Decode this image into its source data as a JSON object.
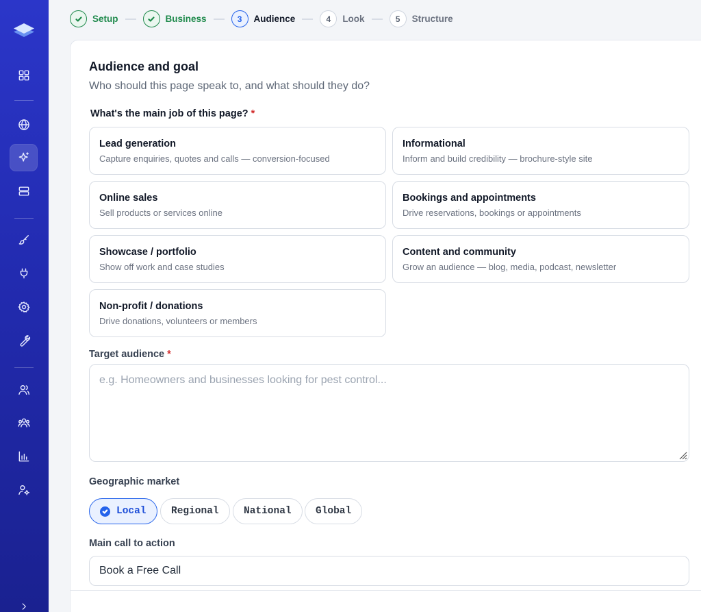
{
  "stepper": {
    "steps": [
      {
        "number": "1",
        "label": "Setup",
        "state": "done"
      },
      {
        "number": "2",
        "label": "Business",
        "state": "done"
      },
      {
        "number": "3",
        "label": "Audience",
        "state": "current"
      },
      {
        "number": "4",
        "label": "Look",
        "state": "todo"
      },
      {
        "number": "5",
        "label": "Structure",
        "state": "todo"
      }
    ]
  },
  "sidebar": {
    "icons": [
      "layers-logo-icon",
      "grid-icon",
      "globe-icon",
      "sparkle-icon",
      "server-icon",
      "brush-icon",
      "plug-icon",
      "gear-icon",
      "wrench-icon",
      "user-icon",
      "users-icon",
      "bar-chart-icon",
      "user-settings-icon",
      "chevron-right-icon"
    ],
    "active": "sparkle-icon"
  },
  "card": {
    "title": "Audience and goal",
    "subtitle": "Who should this page speak to, and what should they do?",
    "main_job_label": "What's the main job of this page?",
    "required_mark": "*",
    "options": [
      {
        "title": "Lead generation",
        "desc": "Capture enquiries, quotes and calls — conversion-focused"
      },
      {
        "title": "Informational",
        "desc": "Inform and build credibility — brochure-style site"
      },
      {
        "title": "Online sales",
        "desc": "Sell products or services online"
      },
      {
        "title": "Bookings and appointments",
        "desc": "Drive reservations, bookings or appointments"
      },
      {
        "title": "Showcase / portfolio",
        "desc": "Show off work and case studies"
      },
      {
        "title": "Content and community",
        "desc": "Grow an audience — blog, media, podcast, newsletter"
      },
      {
        "title": "Non-profit / donations",
        "desc": "Drive donations, volunteers or members"
      }
    ],
    "target_audience": {
      "label": "Target audience",
      "placeholder": "e.g. Homeowners and businesses looking for pest control...",
      "value": ""
    },
    "geographic_market": {
      "label": "Geographic market",
      "options": [
        "Local",
        "Regional",
        "National",
        "Global"
      ],
      "selected": "Local"
    },
    "cta": {
      "label": "Main call to action",
      "value": "Book a Free Call"
    }
  },
  "colors": {
    "sidebar": "#2b36c9",
    "accent": "#2563eb",
    "success": "#1f8a4c",
    "required": "#d12a2a"
  }
}
